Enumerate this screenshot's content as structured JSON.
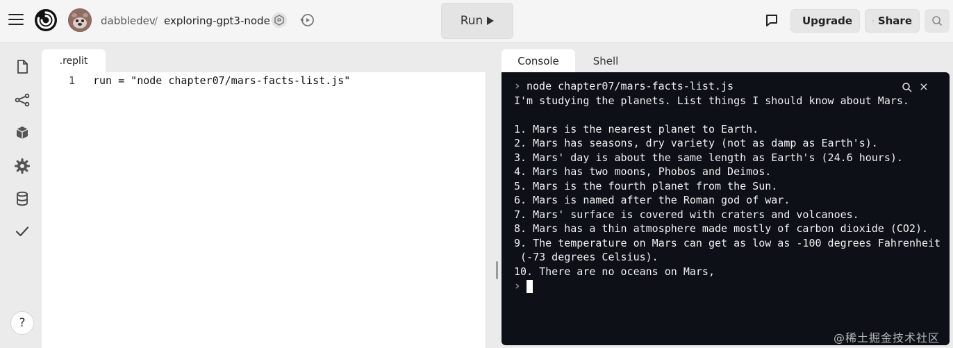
{
  "header": {
    "username": "dabbledev",
    "separator": "/",
    "repl_name": "exploring-gpt3-node",
    "run_label": "Run",
    "upgrade_label": "Upgrade",
    "share_label": "Share"
  },
  "rail": {
    "items": [
      "files-icon",
      "git-icon",
      "packages-icon",
      "settings-icon",
      "database-icon",
      "check-icon"
    ],
    "help_label": "?"
  },
  "editor": {
    "tab_label": ".replit",
    "lines": [
      {
        "number": "1",
        "code": "run = \"node chapter07/mars-facts-list.js\""
      }
    ]
  },
  "console": {
    "tabs": [
      "Console",
      "Shell"
    ],
    "active_tab": "Console",
    "lines": [
      "node chapter07/mars-facts-list.js",
      "I'm studying the planets. List things I should know about Mars.",
      "",
      "1. Mars is the nearest planet to Earth.",
      "2. Mars has seasons, dry variety (not as damp as Earth's).",
      "3. Mars' day is about the same length as Earth's (24.6 hours).",
      "4. Mars has two moons, Phobos and Deimos.",
      "5. Mars is the fourth planet from the Sun.",
      "6. Mars is named after the Roman god of war.",
      "7. Mars' surface is covered with craters and volcanoes.",
      "8. Mars has a thin atmosphere made mostly of carbon dioxide (CO2).",
      "9. The temperature on Mars can get as low as -100 degrees Fahrenheit",
      " (-73 degrees Celsius).",
      "10. There are no oceans on Mars,"
    ],
    "close_glyph": "×"
  },
  "watermark": "@稀土掘金技术社区",
  "colors": {
    "console_bg": "#0d1017",
    "console_text": "#f0f0f0",
    "page_bg": "#ebebeb"
  }
}
